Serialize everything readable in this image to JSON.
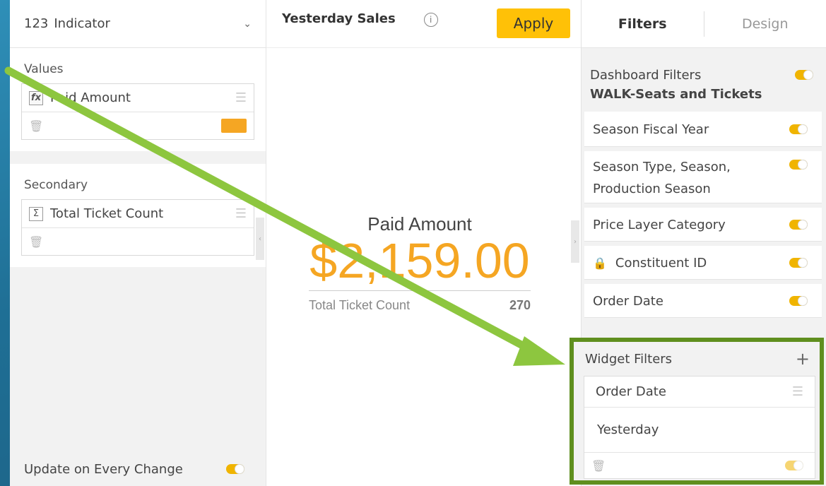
{
  "left": {
    "widget_type": "Indicator",
    "type_prefix": "123",
    "values_title": "Values",
    "values_field": "Paid Amount",
    "values_color": "#f5a623",
    "secondary_title": "Secondary",
    "secondary_field": "Total Ticket Count",
    "update_label": "Update on Every Change"
  },
  "center": {
    "title": "Yesterday Sales",
    "apply_label": "Apply",
    "indicator_title": "Paid Amount",
    "indicator_value": "$2,159.00",
    "secondary_label": "Total Ticket Count",
    "secondary_value": "270"
  },
  "right": {
    "tabs": [
      "Filters",
      "Design"
    ],
    "dashboard_filters_label": "Dashboard Filters",
    "datasource": "WALK-Seats and Tickets",
    "filters": [
      "Season Fiscal Year",
      "Season Type, Season,",
      "Production Season",
      "Price Layer Category",
      "Constituent ID",
      "Order Date"
    ],
    "widget_filters_label": "Widget Filters",
    "widget_filter_field": "Order Date",
    "widget_filter_value": "Yesterday"
  },
  "colors": {
    "accent": "#f5a623",
    "toggle": "#f0b400",
    "apply": "#ffc107",
    "highlight_border": "#5f8f1e",
    "arrow": "#8dc63f"
  }
}
